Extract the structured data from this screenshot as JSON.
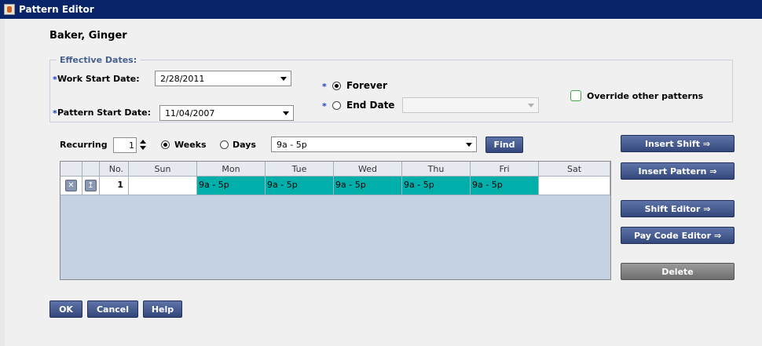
{
  "window": {
    "title": "Pattern Editor"
  },
  "employee": {
    "name": "Baker, Ginger"
  },
  "effective_dates": {
    "legend": "Effective Dates:",
    "required_mark": "*",
    "work_start_label": "Work Start Date:",
    "work_start_value": "2/28/2011",
    "pattern_start_label": "Pattern Start Date:",
    "pattern_start_value": "11/04/2007",
    "forever_label": "Forever",
    "end_date_label": "End Date",
    "end_date_value": "",
    "override_label": "Override other patterns",
    "selected_option": "Forever",
    "override_checked": false
  },
  "recurrence": {
    "label": "Recurring",
    "count": "1",
    "weeks_label": "Weeks",
    "days_label": "Days",
    "selected_unit": "Weeks",
    "shift_value": "9a - 5p",
    "find_label": "Find"
  },
  "grid": {
    "columns": [
      "No.",
      "Sun",
      "Mon",
      "Tue",
      "Wed",
      "Thu",
      "Fri",
      "Sat"
    ],
    "rows": [
      {
        "no": "1",
        "sun": "",
        "mon": "9a - 5p",
        "tue": "9a - 5p",
        "wed": "9a - 5p",
        "thu": "9a - 5p",
        "fri": "9a - 5p",
        "sat": ""
      }
    ],
    "shift_color": "#00aeaa"
  },
  "side_buttons": {
    "insert_shift": "Insert Shift ⇒",
    "insert_pattern": "Insert Pattern ⇒",
    "shift_editor": "Shift Editor ⇒",
    "pay_code_editor": "Pay Code Editor ⇒",
    "delete": "Delete"
  },
  "footer": {
    "ok": "OK",
    "cancel": "Cancel",
    "help": "Help"
  },
  "icons": {
    "app": "java-cup-icon",
    "row_delete": "x-icon",
    "row_insert": "insert-row-icon"
  }
}
